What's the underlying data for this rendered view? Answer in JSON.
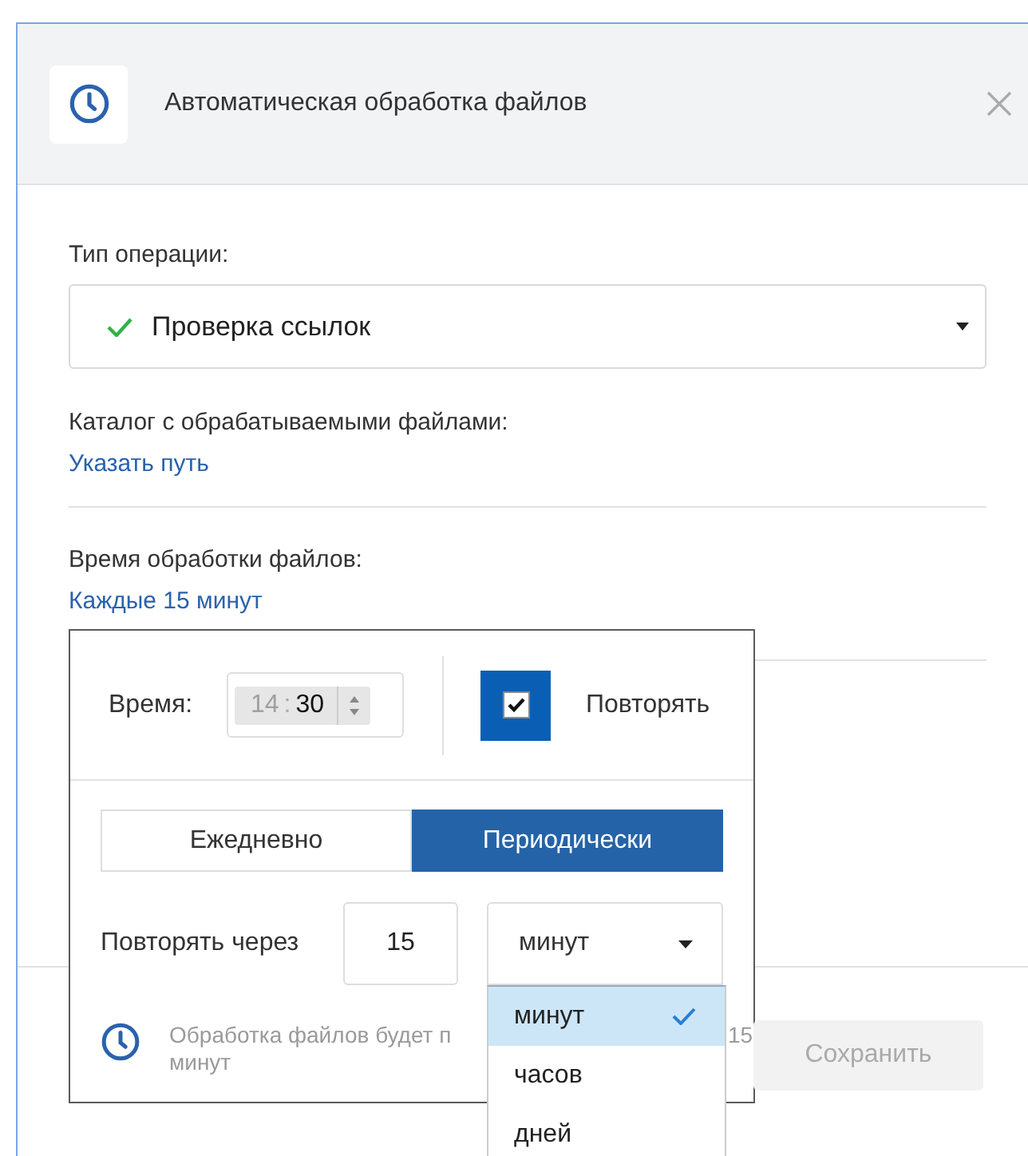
{
  "dialog": {
    "title": "Автоматическая обработка файлов",
    "operation": {
      "label": "Тип операции:",
      "value": "Проверка ссылок"
    },
    "catalog": {
      "label": "Каталог с обрабатываемыми файлами:",
      "link": "Указать путь"
    },
    "schedule": {
      "label": "Время обработки файлов:",
      "link": "Каждые 15 минут"
    },
    "footer": {
      "info_start": "Обработка файлов будет п",
      "info_end": "15",
      "info_second_line": "минут"
    },
    "save_button": {
      "label": "Сохранить",
      "disabled": true
    }
  },
  "schedule_popup": {
    "time_label": "Время:",
    "hours": "14",
    "separator": ":",
    "minutes": "30",
    "hours_dimmed": true,
    "repeat": {
      "label": "Повторять",
      "checked": true
    },
    "modes": [
      {
        "label": "Ежедневно",
        "selected": false
      },
      {
        "label": "Периодически",
        "selected": true
      }
    ],
    "interval": {
      "label": "Повторять через",
      "value": "15",
      "unit": "минут"
    }
  },
  "unit_menu": [
    {
      "label": "минут",
      "selected": true
    },
    {
      "label": "часов",
      "selected": false
    },
    {
      "label": "дней",
      "selected": false
    }
  ]
}
